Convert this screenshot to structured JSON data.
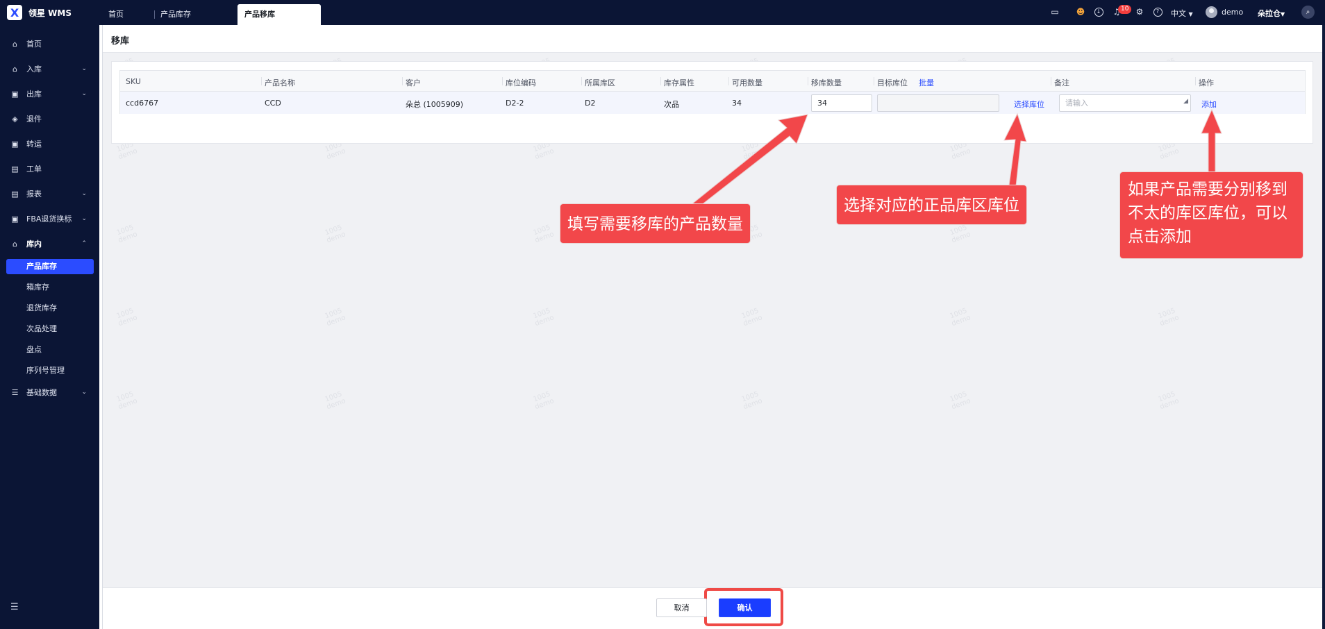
{
  "app": {
    "name": "领星 WMS",
    "logo_glyph": "X"
  },
  "tabs": [
    {
      "label": "首页"
    },
    {
      "label": "产品库存"
    },
    {
      "label": "产品移库"
    }
  ],
  "topbar": {
    "notification_count": "10",
    "language": "中文",
    "user": "demo",
    "warehouse": "朵拉仓"
  },
  "sidebar": {
    "items": [
      {
        "label": "首页",
        "icon": "home-icon",
        "glyph": "⌂"
      },
      {
        "label": "入库",
        "icon": "inbound-icon",
        "glyph": "⌂"
      },
      {
        "label": "出库",
        "icon": "outbound-icon",
        "glyph": "▣"
      },
      {
        "label": "退件",
        "icon": "return-icon",
        "glyph": "◈"
      },
      {
        "label": "转运",
        "icon": "transfer-icon",
        "glyph": "▣"
      },
      {
        "label": "工单",
        "icon": "workorder-icon",
        "glyph": "▤"
      },
      {
        "label": "报表",
        "icon": "report-icon",
        "glyph": "▤"
      },
      {
        "label": "FBA退货换标",
        "icon": "fba-icon",
        "glyph": "▣"
      },
      {
        "label": "库内",
        "icon": "warehouse-icon",
        "glyph": "⌂"
      },
      {
        "label": "基础数据",
        "icon": "data-icon",
        "glyph": "☰"
      }
    ],
    "sub_items": [
      {
        "label": "产品库存"
      },
      {
        "label": "箱库存"
      },
      {
        "label": "退货库存"
      },
      {
        "label": "次品处理"
      },
      {
        "label": "盘点"
      },
      {
        "label": "序列号管理"
      }
    ]
  },
  "page": {
    "title": "移库"
  },
  "table": {
    "headers": [
      "SKU",
      "产品名称",
      "客户",
      "库位编码",
      "所属库区",
      "库存属性",
      "可用数量",
      "移库数量",
      "目标库位",
      "备注",
      "操作"
    ],
    "batch_label": "批量",
    "row": {
      "sku": "ccd6767",
      "product_name": "CCD",
      "customer": "朵总 (1005909)",
      "location_code": "D2-2",
      "zone": "D2",
      "attribute": "次品",
      "available_qty": "34",
      "move_qty": "34",
      "target_location": "",
      "select_location_label": "选择库位",
      "remark_placeholder": "请输入",
      "action_label": "添加"
    }
  },
  "watermark": {
    "line1": "1005",
    "line2": "demo"
  },
  "footer": {
    "cancel_label": "取消",
    "confirm_label": "确认"
  },
  "annotations": [
    {
      "text": "填写需要移库的产品数量"
    },
    {
      "text": "选择对应的正品库区库位"
    },
    {
      "text": "如果产品需要分别移到不太的库区库位，可以点击添加"
    }
  ],
  "colors": {
    "accent": "#2b4cff",
    "nav_bg": "#0b1535",
    "callout": "#f2474a"
  }
}
